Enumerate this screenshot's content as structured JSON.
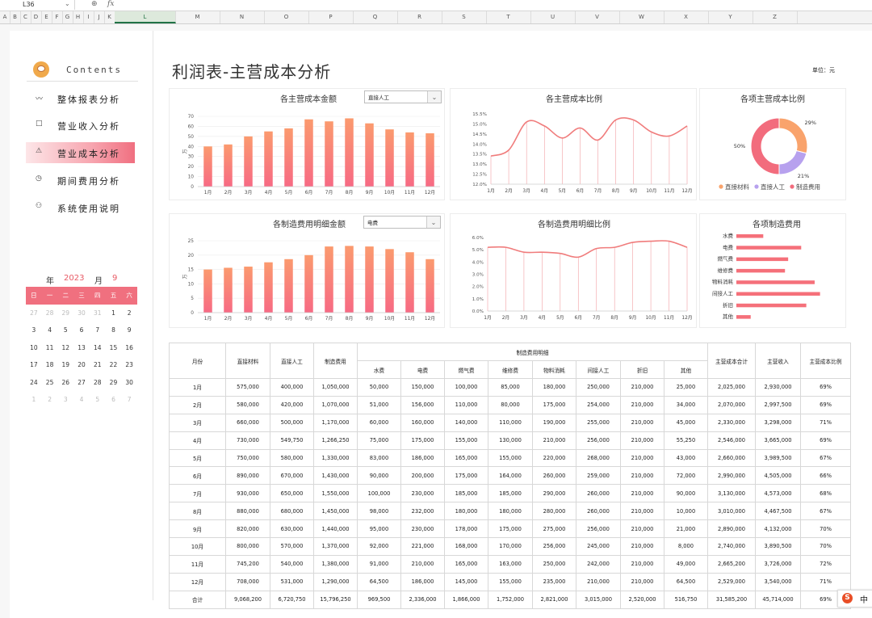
{
  "formula_bar": {
    "cell_ref": "L36",
    "zoom_icon": "magnifier-icon",
    "fx_label": "fx"
  },
  "columns": [
    "A",
    "B",
    "C",
    "D",
    "E",
    "F",
    "G",
    "H",
    "I",
    "J",
    "K",
    "L",
    "M",
    "N",
    "O",
    "P",
    "Q",
    "R",
    "S",
    "T",
    "U",
    "V",
    "W",
    "X",
    "Y",
    "Z"
  ],
  "selected_column": "L",
  "sidebar": {
    "contents_label": "Contents",
    "nav": [
      {
        "icon": "〰",
        "label": "整体报表分析",
        "active": false
      },
      {
        "icon": "□",
        "label": "营业收入分析",
        "active": false
      },
      {
        "icon": "⚠",
        "label": "营业成本分析",
        "active": true
      },
      {
        "icon": "◷",
        "label": "期间费用分析",
        "active": false
      },
      {
        "icon": "⚇",
        "label": "系统使用说明",
        "active": false
      }
    ],
    "calendar": {
      "year_label": "年",
      "year": "2023",
      "month_label": "月",
      "month": "9",
      "weekdays": [
        "日",
        "一",
        "二",
        "三",
        "四",
        "五",
        "六"
      ],
      "weeks": [
        [
          {
            "d": "27",
            "dim": true
          },
          {
            "d": "28",
            "dim": true
          },
          {
            "d": "29",
            "dim": true
          },
          {
            "d": "30",
            "dim": true
          },
          {
            "d": "31",
            "dim": true
          },
          {
            "d": "1"
          },
          {
            "d": "2"
          }
        ],
        [
          {
            "d": "3"
          },
          {
            "d": "4"
          },
          {
            "d": "5"
          },
          {
            "d": "6"
          },
          {
            "d": "7"
          },
          {
            "d": "8"
          },
          {
            "d": "9"
          }
        ],
        [
          {
            "d": "10"
          },
          {
            "d": "11"
          },
          {
            "d": "12"
          },
          {
            "d": "13"
          },
          {
            "d": "14"
          },
          {
            "d": "15"
          },
          {
            "d": "16"
          }
        ],
        [
          {
            "d": "17"
          },
          {
            "d": "18"
          },
          {
            "d": "19"
          },
          {
            "d": "20"
          },
          {
            "d": "21"
          },
          {
            "d": "22"
          },
          {
            "d": "23"
          }
        ],
        [
          {
            "d": "24"
          },
          {
            "d": "25"
          },
          {
            "d": "26"
          },
          {
            "d": "27"
          },
          {
            "d": "28"
          },
          {
            "d": "29"
          },
          {
            "d": "30"
          }
        ],
        [
          {
            "d": "1",
            "dim": true
          },
          {
            "d": "2",
            "dim": true
          },
          {
            "d": "3",
            "dim": true
          },
          {
            "d": "4",
            "dim": true
          },
          {
            "d": "5",
            "dim": true
          },
          {
            "d": "6",
            "dim": true
          },
          {
            "d": "7",
            "dim": true
          }
        ]
      ]
    }
  },
  "header": {
    "title": "利润表-主营成本分析",
    "unit": "单位：元"
  },
  "colors": {
    "accent": "#f0707f",
    "bar_top": "#fb9a6e",
    "bar_bottom": "#f76a84",
    "line": "#f07c7c",
    "donut_orange": "#f9a36c",
    "donut_purple": "#b7a1ee",
    "donut_pink": "#f26c7d",
    "hbar": "#f5707a"
  },
  "dropdowns": {
    "cost_type": "直接人工",
    "mfg_item": "电费"
  },
  "months": [
    "1月",
    "2月",
    "3月",
    "4月",
    "5月",
    "6月",
    "7月",
    "8月",
    "9月",
    "10月",
    "11月",
    "12月"
  ],
  "chart_data": [
    {
      "type": "bar",
      "title": "各主营成本金额",
      "ylabel": "万",
      "ylim": [
        0,
        70
      ],
      "yticks": [
        0,
        10,
        20,
        30,
        40,
        50,
        60,
        70
      ],
      "categories": [
        "1月",
        "2月",
        "3月",
        "4月",
        "5月",
        "6月",
        "7月",
        "8月",
        "9月",
        "10月",
        "11月",
        "12月"
      ],
      "values": [
        40,
        42,
        50,
        54.98,
        58,
        67,
        65,
        68,
        63,
        57,
        54,
        53.1
      ]
    },
    {
      "type": "line",
      "title": "各主营成本比例",
      "ylim": [
        12.0,
        15.5
      ],
      "yticks": [
        "12.0%",
        "12.5%",
        "13.0%",
        "13.5%",
        "14.0%",
        "14.5%",
        "15.0%",
        "15.5%"
      ],
      "categories": [
        "1月",
        "2月",
        "3月",
        "4月",
        "5月",
        "6月",
        "7月",
        "8月",
        "9月",
        "10月",
        "11月",
        "12月"
      ],
      "values": [
        13.4,
        13.7,
        15.1,
        14.9,
        14.3,
        14.8,
        14.2,
        15.2,
        15.2,
        14.6,
        14.4,
        14.9
      ]
    },
    {
      "type": "pie",
      "title": "各项主营成本比例",
      "labels": [
        "直接材料",
        "直接人工",
        "制造费用"
      ],
      "values": [
        29,
        21,
        50
      ],
      "data_labels": [
        "29%",
        "21%",
        "50%"
      ]
    },
    {
      "type": "bar",
      "title": "各制造费用明细金额",
      "ylabel": "万",
      "ylim": [
        0,
        25
      ],
      "yticks": [
        0,
        5,
        10,
        15,
        20,
        25
      ],
      "categories": [
        "1月",
        "2月",
        "3月",
        "4月",
        "5月",
        "6月",
        "7月",
        "8月",
        "9月",
        "10月",
        "11月",
        "12月"
      ],
      "values": [
        15,
        15.6,
        16,
        17.5,
        18.6,
        20,
        23,
        23.2,
        23,
        22.1,
        21,
        18.6
      ]
    },
    {
      "type": "line",
      "title": "各制造费用明细比例",
      "ylim": [
        0,
        6
      ],
      "yticks": [
        "0.0%",
        "1.0%",
        "2.0%",
        "3.0%",
        "4.0%",
        "5.0%",
        "6.0%"
      ],
      "categories": [
        "1月",
        "2月",
        "3月",
        "4月",
        "5月",
        "6月",
        "7月",
        "8月",
        "9月",
        "10月",
        "11月",
        "12月"
      ],
      "values": [
        5.2,
        5.2,
        4.8,
        4.8,
        4.7,
        4.4,
        5.1,
        5.2,
        5.6,
        5.7,
        5.7,
        5.2
      ]
    },
    {
      "type": "bar",
      "title": "各项制造费用",
      "orientation": "horizontal",
      "categories": [
        "水费",
        "电费",
        "燃气费",
        "维修费",
        "物料消耗",
        "间接人工",
        "折旧",
        "其他"
      ],
      "values": [
        969500,
        2336000,
        1866000,
        1752000,
        2821000,
        3015000,
        2520000,
        516750
      ]
    }
  ],
  "table": {
    "headers": {
      "month": "月份",
      "material": "直接材料",
      "labor": "直接人工",
      "mfg": "制造费用",
      "detail_group": "制造费用明细",
      "detail": [
        "水费",
        "电费",
        "燃气费",
        "维修费",
        "物料消耗",
        "间接人工",
        "折旧",
        "其他"
      ],
      "total": "主营成本合计",
      "revenue": "主营收入",
      "ratio": "主营成本比例"
    },
    "rows": [
      [
        "1月",
        "575,000",
        "400,000",
        "1,050,000",
        "50,000",
        "150,000",
        "100,000",
        "85,000",
        "180,000",
        "250,000",
        "210,000",
        "25,000",
        "2,025,000",
        "2,930,000",
        "69%"
      ],
      [
        "2月",
        "580,000",
        "420,000",
        "1,070,000",
        "51,000",
        "156,000",
        "110,000",
        "80,000",
        "175,000",
        "254,000",
        "210,000",
        "34,000",
        "2,070,000",
        "2,997,500",
        "69%"
      ],
      [
        "3月",
        "660,000",
        "500,000",
        "1,170,000",
        "60,000",
        "160,000",
        "140,000",
        "110,000",
        "190,000",
        "255,000",
        "210,000",
        "45,000",
        "2,330,000",
        "3,298,000",
        "71%"
      ],
      [
        "4月",
        "730,000",
        "549,750",
        "1,266,250",
        "75,000",
        "175,000",
        "155,000",
        "130,000",
        "210,000",
        "256,000",
        "210,000",
        "55,250",
        "2,546,000",
        "3,665,000",
        "69%"
      ],
      [
        "5月",
        "750,000",
        "580,000",
        "1,330,000",
        "83,000",
        "186,000",
        "165,000",
        "155,000",
        "220,000",
        "268,000",
        "210,000",
        "43,000",
        "2,660,000",
        "3,989,500",
        "67%"
      ],
      [
        "6月",
        "890,000",
        "670,000",
        "1,430,000",
        "90,000",
        "200,000",
        "175,000",
        "164,000",
        "260,000",
        "259,000",
        "210,000",
        "72,000",
        "2,990,000",
        "4,505,000",
        "66%"
      ],
      [
        "7月",
        "930,000",
        "650,000",
        "1,550,000",
        "100,000",
        "230,000",
        "185,000",
        "185,000",
        "290,000",
        "260,000",
        "210,000",
        "90,000",
        "3,130,000",
        "4,573,000",
        "68%"
      ],
      [
        "8月",
        "880,000",
        "680,000",
        "1,450,000",
        "98,000",
        "232,000",
        "180,000",
        "180,000",
        "280,000",
        "260,000",
        "210,000",
        "10,000",
        "3,010,000",
        "4,467,500",
        "67%"
      ],
      [
        "9月",
        "820,000",
        "630,000",
        "1,440,000",
        "95,000",
        "230,000",
        "178,000",
        "175,000",
        "275,000",
        "256,000",
        "210,000",
        "21,000",
        "2,890,000",
        "4,132,000",
        "70%"
      ],
      [
        "10月",
        "800,000",
        "570,000",
        "1,370,000",
        "92,000",
        "221,000",
        "168,000",
        "170,000",
        "256,000",
        "245,000",
        "210,000",
        "8,000",
        "2,740,000",
        "3,890,500",
        "70%"
      ],
      [
        "11月",
        "745,200",
        "540,000",
        "1,380,000",
        "91,000",
        "210,000",
        "165,000",
        "163,000",
        "250,000",
        "242,000",
        "210,000",
        "49,000",
        "2,665,200",
        "3,726,000",
        "72%"
      ],
      [
        "12月",
        "708,000",
        "531,000",
        "1,290,000",
        "64,500",
        "186,000",
        "145,000",
        "155,000",
        "235,000",
        "210,000",
        "210,000",
        "64,500",
        "2,529,000",
        "3,540,000",
        "71%"
      ],
      [
        "合计",
        "9,068,200",
        "6,720,750",
        "15,796,250",
        "969,500",
        "2,336,000",
        "1,866,000",
        "1,752,000",
        "2,821,000",
        "3,015,000",
        "2,520,000",
        "516,750",
        "31,585,200",
        "45,714,000",
        "69%"
      ]
    ]
  },
  "ime": {
    "logo": "S",
    "mode": "中"
  }
}
